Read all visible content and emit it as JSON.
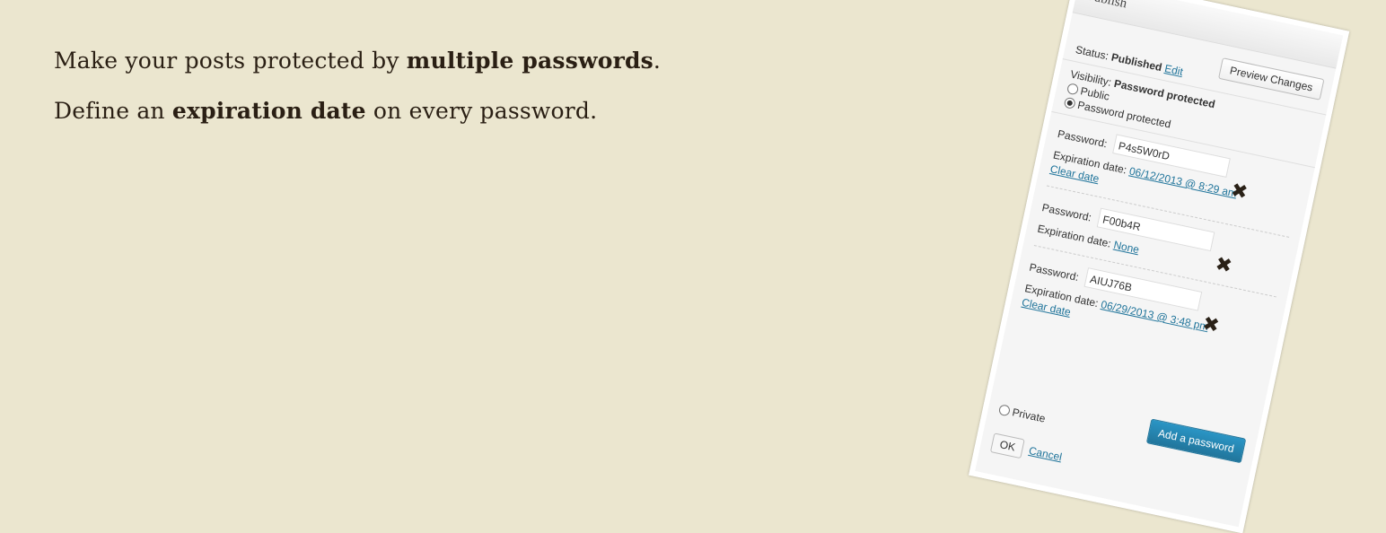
{
  "hero": {
    "line1_pre": "Make your posts protected by ",
    "line1_bold": "multiple passwords",
    "line1_post": ".",
    "line2_pre": "Define an ",
    "line2_bold": "expiration date",
    "line2_post": " on every password."
  },
  "publish": {
    "title": "Publish",
    "preview_button": "Preview Changes",
    "status_label": "Status:",
    "status_value": "Published",
    "status_edit": "Edit",
    "visibility_label": "Visibility:",
    "visibility_value": "Password protected",
    "option_public": "Public",
    "option_password": "Password protected",
    "option_private": "Private",
    "password_label": "Password:",
    "expiration_label": "Expiration date:",
    "clear_date": "Clear date",
    "passwords": [
      {
        "value": "P4s5W0rD",
        "expiration": "06/12/2013 @ 8:29 am"
      },
      {
        "value": "F00b4R",
        "expiration": "None"
      },
      {
        "value": "AIUJ76B",
        "expiration": "06/29/2013 @ 3:48 pm"
      }
    ],
    "add_button": "Add a password",
    "ok_button": "OK",
    "cancel_link": "Cancel"
  },
  "colors": {
    "background": "#ebe6cf",
    "text": "#2a1f14",
    "link": "#21759b",
    "button": "#21759b"
  },
  "icons": {
    "remove": "close-x-icon"
  }
}
